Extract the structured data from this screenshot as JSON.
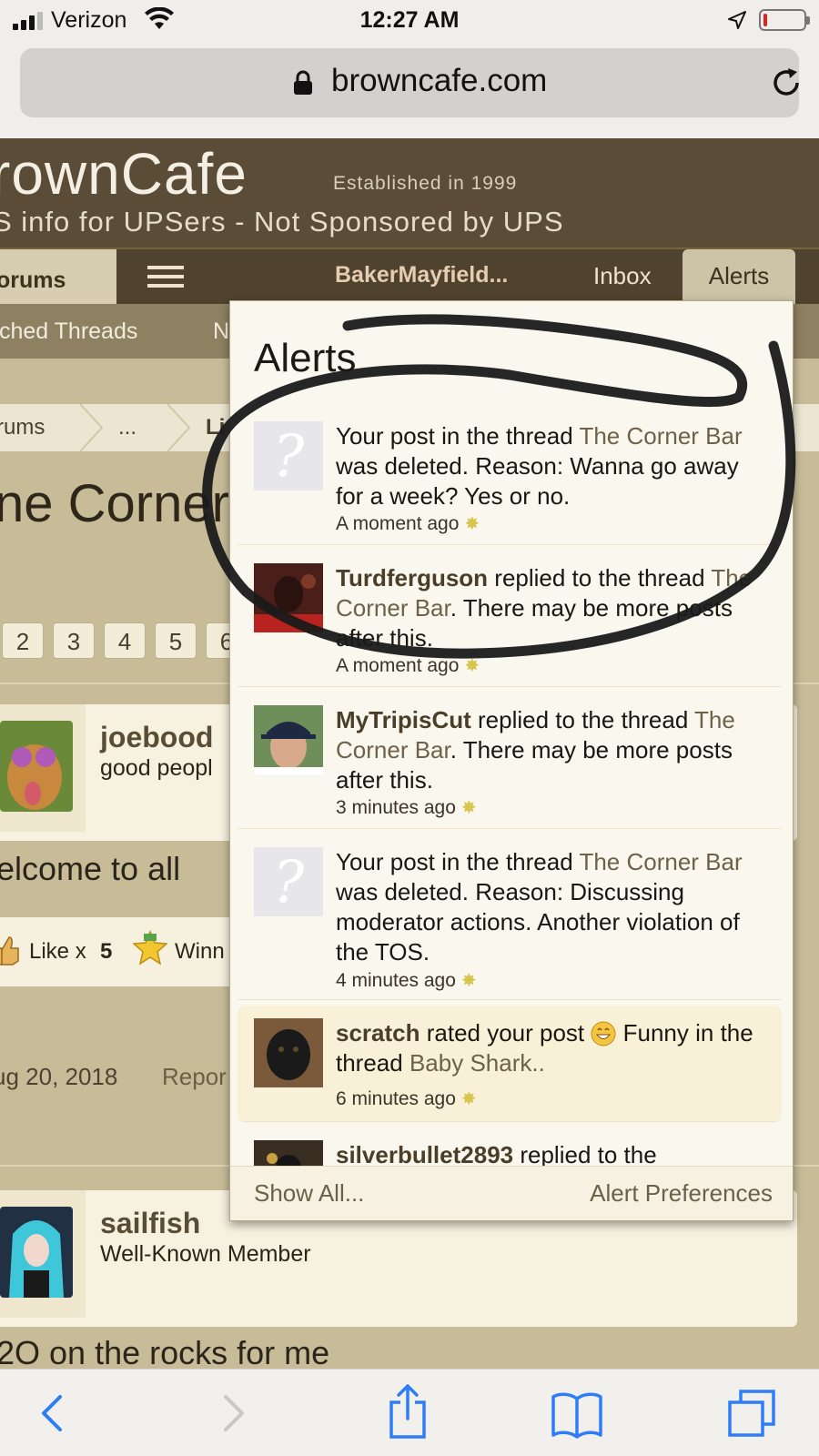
{
  "status_bar": {
    "carrier": "Verizon",
    "time": "12:27 AM",
    "battery_level": 0.1
  },
  "browser": {
    "url": "browncafe.com"
  },
  "site": {
    "brand": "rownCafe",
    "established": "Established in 1999",
    "tagline": "S info for UPSers - Not Sponsored by UPS"
  },
  "nav": {
    "forums": "orums",
    "user": "BakerMayfield...",
    "inbox": "Inbox",
    "alerts": "Alerts"
  },
  "subnav": {
    "watched": "tched Threads",
    "new_posts": "N"
  },
  "page": {
    "breadcrumbs": [
      "rums",
      "...",
      "Li"
    ],
    "title": "ne Corner",
    "pages": [
      "2",
      "3",
      "4",
      "5",
      "6"
    ],
    "post1": {
      "name": "joebood",
      "subtitle": "good peopl",
      "body": "elcome to all"
    },
    "likes": {
      "like_label": "Like x",
      "like_count": "5",
      "winner_label": "Winn"
    },
    "post_date": "ug 20, 2018",
    "report": "Repor",
    "post2": {
      "name": "sailfish",
      "subtitle": "Well-Known Member",
      "body": "2O on the rocks for me"
    }
  },
  "alerts_popup": {
    "title": "Alerts",
    "items": [
      {
        "prefix": "Your post in the thread ",
        "link": "The Corner Bar",
        "suffix": " was deleted. Reason: Wanna go away for a week? Yes or no.",
        "time": "A moment ago",
        "avatar": "placeholder-avatar-icon"
      },
      {
        "user": "Turdferguson",
        "prefix": " replied to the thread ",
        "link": "The Corner Bar",
        "suffix": ". There may be more posts after this.",
        "time": "A moment ago",
        "avatar": "user-photo"
      },
      {
        "user": "MyTripisCut",
        "prefix": " replied to the thread ",
        "link": "The Corner Bar",
        "suffix": ". There may be more posts after this.",
        "time": "3 minutes ago",
        "avatar": "user-photo"
      },
      {
        "prefix": "Your post in the thread ",
        "link": "The Corner Bar",
        "suffix": " was deleted. Reason: Discussing moderator actions. Another violation of the TOS.",
        "time": "4 minutes ago",
        "avatar": "placeholder-avatar-icon"
      },
      {
        "user": "scratch",
        "prefix": " rated your post ",
        "rating": "Funny",
        "prefix2": " in the thread ",
        "link": "Baby Shark..",
        "suffix": "",
        "time": "6 minutes ago",
        "avatar": "dog-photo"
      },
      {
        "user": "silverbullet2893",
        "prefix": " replied to the",
        "link": "",
        "suffix": "",
        "time": "",
        "avatar": "user-photo"
      }
    ],
    "show_all": "Show All...",
    "preferences": "Alert Preferences"
  },
  "colors": {
    "header_brown": "#5a4c36",
    "nav_brown": "#4f432f",
    "popup_bg": "#faf7ee",
    "link_color": "#6d6249",
    "ink": "#1a1a1a",
    "ios_blue": "#2f7df6"
  }
}
